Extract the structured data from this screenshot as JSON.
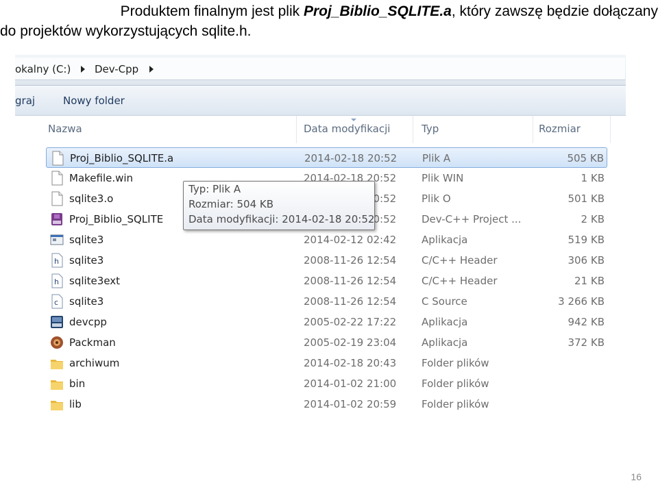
{
  "caption": {
    "text_before": "Produktem finalnym jest plik ",
    "filename": "Proj_Biblio_SQLITE.a",
    "text_after": ", który zawszę będzie dołączany",
    "line2": "do projektów wykorzystujących sqlite.h."
  },
  "breadcrumb": {
    "drive": "okalny (C:)",
    "folder": "Dev-Cpp"
  },
  "toolbar": {
    "organize": "graj",
    "new_folder": "Nowy folder"
  },
  "columns": {
    "name": "Nazwa",
    "date": "Data modyfikacji",
    "type": "Typ",
    "size": "Rozmiar"
  },
  "files": [
    {
      "name": "Proj_Biblio_SQLITE.a",
      "date": "2014-02-18 20:52",
      "type": "Plik A",
      "size": "505 KB",
      "icon": "file-icon"
    },
    {
      "name": "Makefile.win",
      "date": "2014-02-18 20:52",
      "type": "Plik WIN",
      "size": "1 KB",
      "icon": "file-icon"
    },
    {
      "name": "sqlite3.o",
      "date": "2014-02-18 20:52",
      "type": "Plik O",
      "size": "501 KB",
      "icon": "file-icon"
    },
    {
      "name": "Proj_Biblio_SQLITE",
      "date": "2014-02-18 20:52",
      "type": "Dev-C++ Project ...",
      "size": "2 KB",
      "icon": "devcpp-project-icon"
    },
    {
      "name": "sqlite3",
      "date": "2014-02-12 02:42",
      "type": "Aplikacja",
      "size": "519 KB",
      "icon": "application-icon"
    },
    {
      "name": "sqlite3",
      "date": "2008-11-26 12:54",
      "type": "C/C++ Header",
      "size": "306 KB",
      "icon": "header-file-icon"
    },
    {
      "name": "sqlite3ext",
      "date": "2008-11-26 12:54",
      "type": "C/C++ Header",
      "size": "21 KB",
      "icon": "header-file-icon"
    },
    {
      "name": "sqlite3",
      "date": "2008-11-26 12:54",
      "type": "C Source",
      "size": "3 266 KB",
      "icon": "c-source-icon"
    },
    {
      "name": "devcpp",
      "date": "2005-02-22 17:22",
      "type": "Aplikacja",
      "size": "942 KB",
      "icon": "devcpp-app-icon"
    },
    {
      "name": "Packman",
      "date": "2005-02-19 23:04",
      "type": "Aplikacja",
      "size": "372 KB",
      "icon": "packman-icon"
    },
    {
      "name": "archiwum",
      "date": "2014-02-18 20:43",
      "type": "Folder plików",
      "size": "",
      "icon": "folder-icon"
    },
    {
      "name": "bin",
      "date": "2014-01-02 21:00",
      "type": "Folder plików",
      "size": "",
      "icon": "folder-icon"
    },
    {
      "name": "lib",
      "date": "2014-01-02 20:59",
      "type": "Folder plików",
      "size": "",
      "icon": "folder-icon"
    }
  ],
  "tooltip": {
    "type": "Typ: Plik A",
    "size": "Rozmiar: 504 KB",
    "modified": "Data modyfikacji: 2014-02-18 20:52"
  },
  "page_number": "16"
}
